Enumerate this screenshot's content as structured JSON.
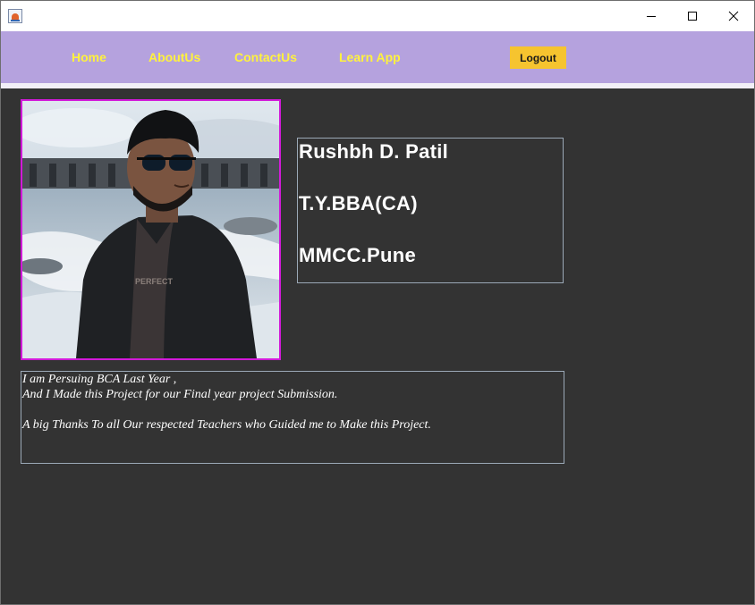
{
  "window": {
    "title": ""
  },
  "nav": {
    "items": [
      "Home",
      "AboutUs",
      "ContactUs",
      "Learn App"
    ],
    "logout_label": "Logout"
  },
  "profile": {
    "name": "Rushbh D. Patil",
    "course": "T.Y.BBA(CA)",
    "college": "MMCC.Pune"
  },
  "description": {
    "lines": [
      "I am Persuing BCA Last Year ,",
      "And I Made this Project for our Final year project Submission.",
      "",
      "A big Thanks To all Our respected Teachers who Guided me to Make this Project."
    ]
  },
  "colors": {
    "nav_background": "#b5a2de",
    "nav_text": "#fff23d",
    "logout_background": "#f6c42f",
    "content_background": "#333333",
    "photo_border": "#d21ad9"
  },
  "icons": [
    "java-app-icon",
    "minimize-icon",
    "maximize-icon",
    "close-icon"
  ]
}
